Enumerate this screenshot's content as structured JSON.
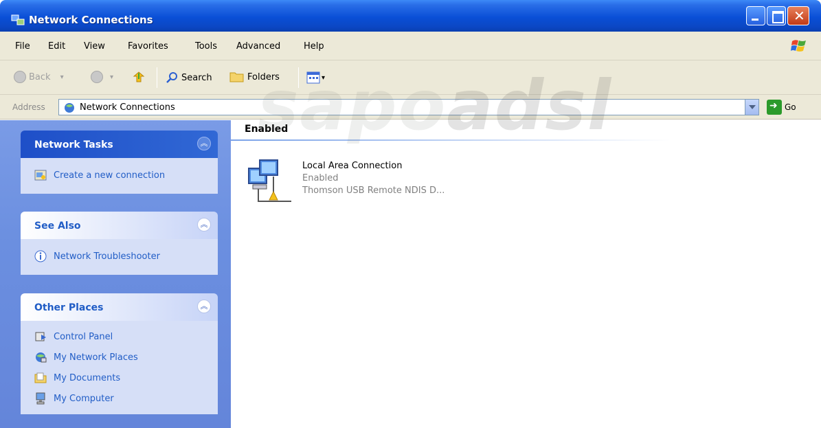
{
  "window": {
    "title": "Network Connections",
    "icon": "network-connections-icon",
    "controls": [
      "minimize",
      "maximize",
      "close"
    ]
  },
  "menubar": {
    "items": [
      {
        "label": "File"
      },
      {
        "label": "Edit"
      },
      {
        "label": "View"
      },
      {
        "label": "Favorites"
      },
      {
        "label": "Tools"
      },
      {
        "label": "Advanced"
      },
      {
        "label": "Help"
      }
    ]
  },
  "toolbar": {
    "back_label": "Back",
    "search_label": "Search",
    "folders_label": "Folders"
  },
  "address": {
    "label": "Address",
    "value": "Network Connections",
    "go_label": "Go"
  },
  "left_pane": {
    "network_tasks": {
      "title": "Network Tasks",
      "items": [
        {
          "label": "Create a new connection",
          "icon": "new-connection-icon"
        }
      ]
    },
    "see_also": {
      "title": "See Also",
      "items": [
        {
          "label": "Network Troubleshooter",
          "icon": "info-icon"
        }
      ]
    },
    "other_places": {
      "title": "Other Places",
      "items": [
        {
          "label": "Control Panel",
          "icon": "control-panel-icon"
        },
        {
          "label": "My Network Places",
          "icon": "my-network-places-icon"
        },
        {
          "label": "My Documents",
          "icon": "my-documents-icon"
        },
        {
          "label": "My Computer",
          "icon": "my-computer-icon"
        }
      ]
    }
  },
  "main": {
    "group_header": "Enabled",
    "connections": [
      {
        "name": "Local Area Connection",
        "status": "Enabled",
        "device": "Thomson USB Remote NDIS D..."
      }
    ]
  },
  "watermark": {
    "text_a": "sapo",
    "text_b": "adsl"
  },
  "colors": {
    "titlebar": "#0a4fd6",
    "task_pane": "#6b8fe0",
    "task_text": "#215dc6",
    "chrome": "#ece9d8"
  }
}
